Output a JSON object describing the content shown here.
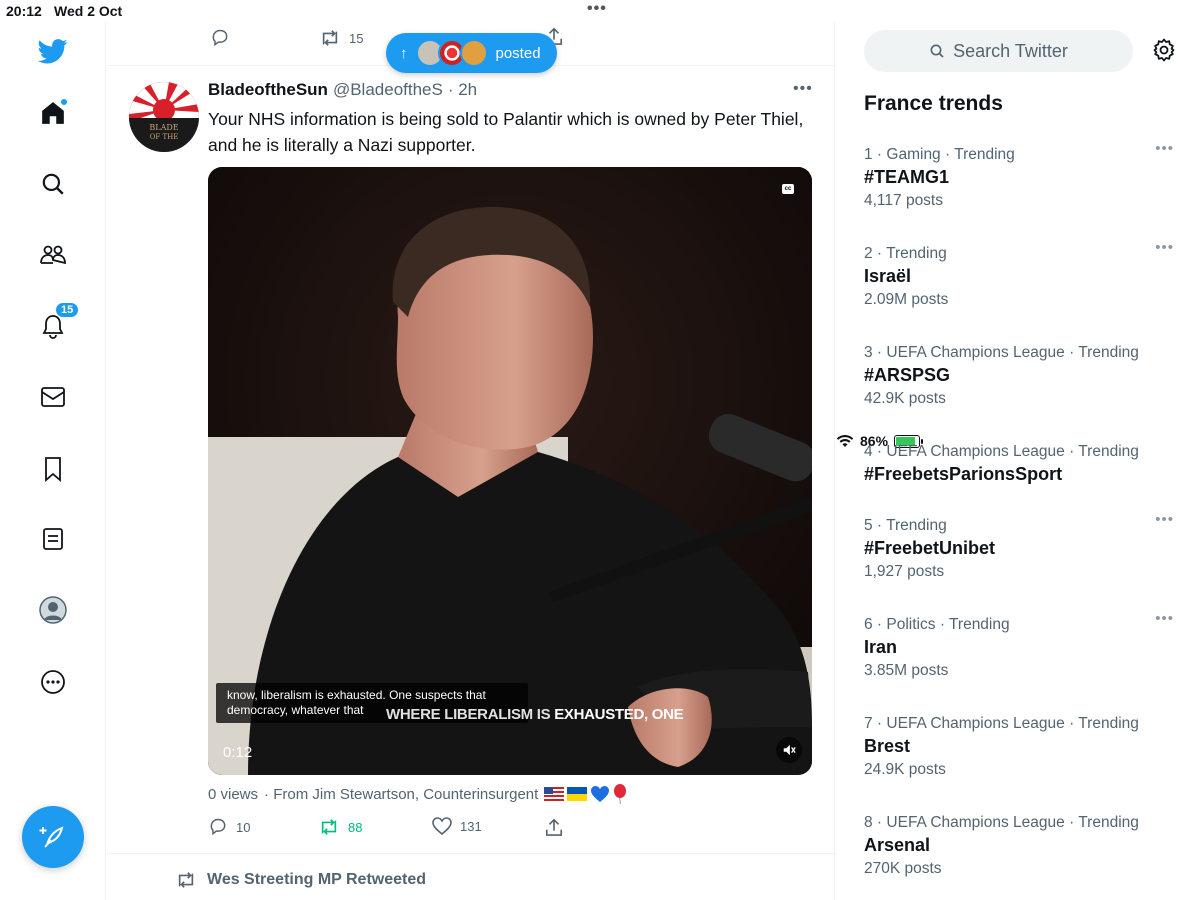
{
  "status_bar": {
    "time": "20:12",
    "date": "Wed 2 Oct",
    "battery": "86%",
    "battery_level": 0.86
  },
  "nav": {
    "notifications_badge": "15",
    "brand_color": "#1d9bf0"
  },
  "previous_tweet": {
    "retweets": "15"
  },
  "new_posts_pill": {
    "label": "posted",
    "arrow": "↑"
  },
  "tweet": {
    "author_name": "BladeoftheSun",
    "author_handle": "@BladeoftheS",
    "time": "· 2h",
    "text": "Your NHS information is being sold to Palantir which is owned by Peter Thiel, and he is literally a Nazi supporter.",
    "video": {
      "cc_label": "cc",
      "caption": "know, liberalism is exhausted. One suspects that democracy, whatever that",
      "burned_text_a": "WHERE LIBERALISM IS",
      "burned_text_b": "EXHAUSTED, ONE",
      "timecode": "0:12"
    },
    "views": "0 views",
    "attribution": "· From Jim Stewartson, Counterinsurgent",
    "replies": "10",
    "retweets": "88",
    "likes": "131"
  },
  "next_item": {
    "retweeted_by": "Wes Streeting MP Retweeted"
  },
  "sidebar": {
    "search_placeholder": "Search Twitter",
    "trends_title": "France trends",
    "trends": [
      {
        "rank": "1",
        "context": "Gaming",
        "status": "Trending",
        "name": "#TEAMG1",
        "posts": "4,117 posts"
      },
      {
        "rank": "2",
        "context": "",
        "status": "Trending",
        "name": "Israël",
        "posts": "2.09M posts"
      },
      {
        "rank": "3",
        "context": "UEFA Champions League",
        "status": "Trending",
        "name": "#ARSPSG",
        "posts": "42.9K posts"
      },
      {
        "rank": "4",
        "context": "UEFA Champions League",
        "status": "Trending",
        "name": "#FreebetsParionsSport",
        "posts": ""
      },
      {
        "rank": "5",
        "context": "",
        "status": "Trending",
        "name": "#FreebetUnibet",
        "posts": "1,927 posts"
      },
      {
        "rank": "6",
        "context": "Politics",
        "status": "Trending",
        "name": "Iran",
        "posts": "3.85M posts"
      },
      {
        "rank": "7",
        "context": "UEFA Champions League",
        "status": "Trending",
        "name": "Brest",
        "posts": "24.9K posts"
      },
      {
        "rank": "8",
        "context": "UEFA Champions League",
        "status": "Trending",
        "name": "Arsenal",
        "posts": "270K posts"
      }
    ]
  }
}
